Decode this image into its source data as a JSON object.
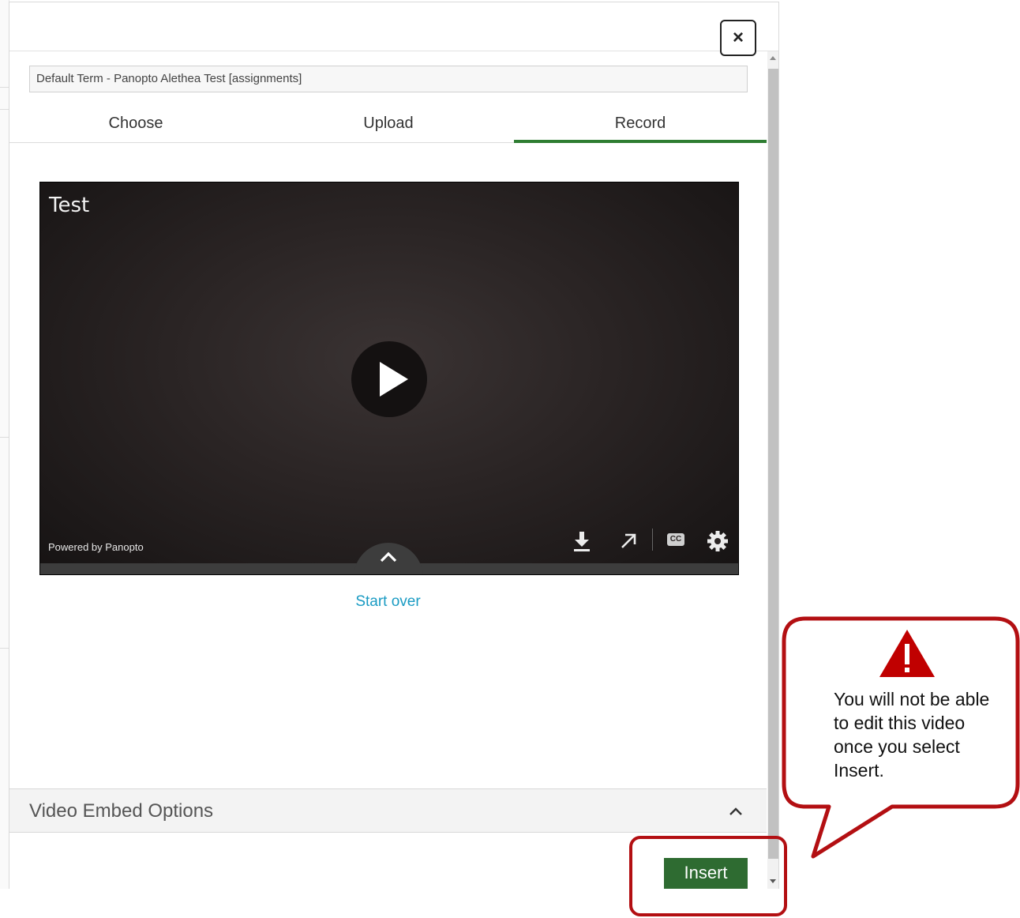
{
  "dialog": {
    "close_label": "×",
    "folder": "Default Term - Panopto Alethea Test [assignments]",
    "tabs": [
      {
        "label": "Choose"
      },
      {
        "label": "Upload"
      },
      {
        "label": "Record",
        "active": true
      }
    ],
    "video": {
      "title": "Test",
      "powered_by": "Powered by Panopto",
      "play_icon": "play-icon",
      "controls": [
        "download-icon",
        "open-external-icon",
        "closed-captions-icon",
        "settings-gear-icon"
      ],
      "cc_label": "CC"
    },
    "start_over": "Start over",
    "embed_options": "Video Embed Options",
    "insert_label": "Insert"
  },
  "callout": {
    "text": "You will not be able to edit this video once you select Insert.",
    "icon": "warning-icon",
    "color": "#b30f12"
  },
  "colors": {
    "accent": "#2e7d32",
    "insert_button": "#2e6b31",
    "link": "#1a9bc3",
    "annotation": "#b30f12"
  }
}
